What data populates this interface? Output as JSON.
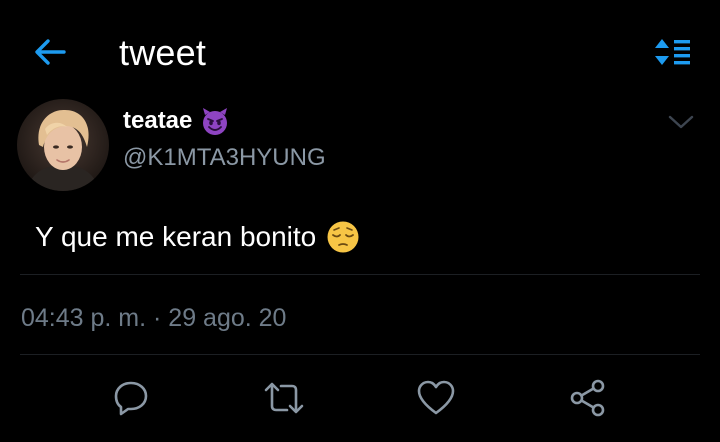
{
  "header": {
    "title": "tweet",
    "back_icon": "arrow-left-icon",
    "sort_icon": "sort-list-icon",
    "accent_color": "#1d9bf0"
  },
  "tweet": {
    "display_name": "teatae",
    "name_emoji": "smiling-devil-emoji",
    "handle": "@K1MTA3HYUNG",
    "text": "Y que me keran bonito",
    "text_emoji": "pensive-face-emoji",
    "timestamp": "04:43 p. m. · 29 ago. 20"
  },
  "actions": [
    {
      "name": "reply",
      "icon": "reply-icon"
    },
    {
      "name": "retweet",
      "icon": "retweet-icon"
    },
    {
      "name": "like",
      "icon": "heart-icon"
    },
    {
      "name": "share",
      "icon": "share-icon"
    }
  ],
  "colors": {
    "background": "#000000",
    "secondary_text": "#8b98a5",
    "icon_color": "#8b98a5"
  }
}
